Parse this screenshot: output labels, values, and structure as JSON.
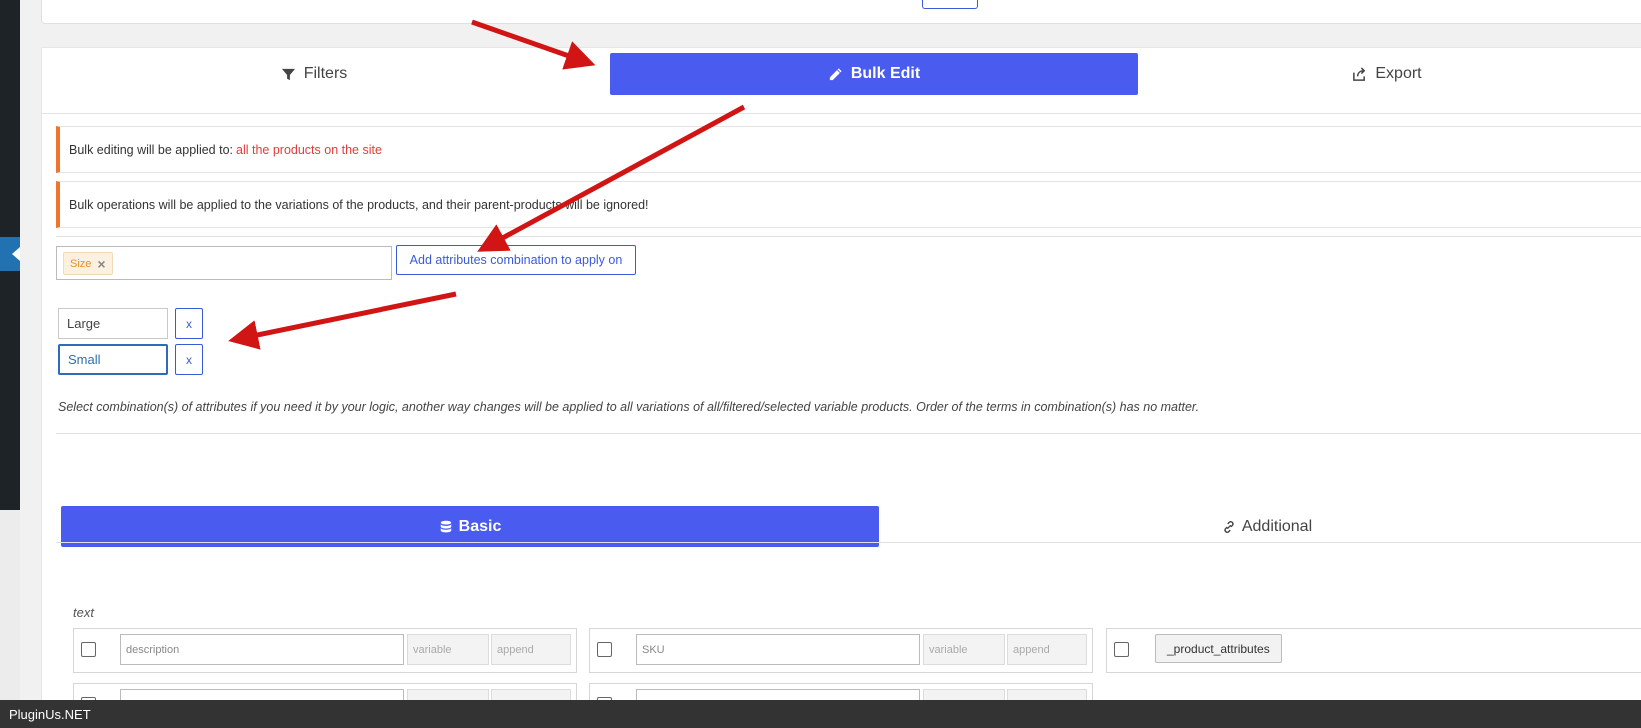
{
  "tabs": {
    "filters_label": "Filters",
    "bulk_edit_label": "Bulk Edit",
    "export_label": "Export"
  },
  "notices": {
    "applied_to_prefix": "Bulk editing will be applied to:",
    "applied_to_target": "all the products on the site",
    "variations_note": "Bulk operations will be applied to the variations of the products, and their parent-products will be ignored!"
  },
  "attributes": {
    "selected_chip": "Size",
    "chip_remove": "×",
    "add_combination_label": "Add attributes combination to apply on",
    "terms": [
      {
        "value": "Large",
        "remove_label": "x"
      },
      {
        "value": "Small",
        "remove_label": "x"
      }
    ],
    "hint": "Select combination(s) of attributes if you need it by your logic, another way changes will be applied to all variations of all/filtered/selected variable products. Order of the terms in combination(s) has no matter."
  },
  "bulk_tabs": {
    "basic_label": "Basic",
    "additional_label": "Additional"
  },
  "fields": {
    "group_label": "text",
    "description": {
      "placeholder": "description",
      "variable": "variable",
      "append": "append"
    },
    "sku": {
      "placeholder": "SKU",
      "variable": "variable",
      "append": "append"
    },
    "product_attributes_label": "_product_attributes"
  },
  "footer": {
    "brand": "PluginUs.NET"
  },
  "colors": {
    "accent": "#4a5bf0",
    "notice_border": "#f0742c",
    "highlight_text": "#e53b3b",
    "annotation_arrow": "#d11515"
  },
  "icons": {
    "filters": "filter-icon",
    "bulk_edit": "pencil-icon",
    "export": "share-icon",
    "basic": "database-icon",
    "additional": "link-icon"
  }
}
